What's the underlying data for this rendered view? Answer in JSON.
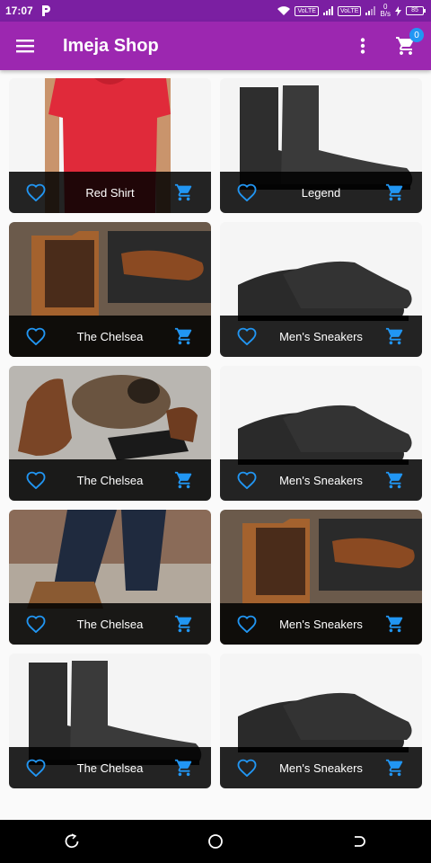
{
  "status_bar": {
    "time": "17:07",
    "volte_1": "VoLTE",
    "volte_2": "VoLTE",
    "speed_value": "0",
    "speed_unit": "B/s",
    "battery": "85"
  },
  "app_bar": {
    "title": "Imeja Shop",
    "cart_count": "0",
    "color": "#9c27b0"
  },
  "accent_color": "#2196f3",
  "products": [
    {
      "name": "Red Shirt",
      "image": "red-shirt"
    },
    {
      "name": "Legend",
      "image": "black-chelsea-boots"
    },
    {
      "name": "The Chelsea",
      "image": "brown-chelsea-boot"
    },
    {
      "name": "Men's Sneakers",
      "image": "black-sneakers"
    },
    {
      "name": "The Chelsea",
      "image": "brown-lace-boots-dog"
    },
    {
      "name": "Men's Sneakers",
      "image": "black-sneakers"
    },
    {
      "name": "The Chelsea",
      "image": "jeans-brown-boots"
    },
    {
      "name": "Men's Sneakers",
      "image": "brown-chelsea-boot"
    },
    {
      "name": "The Chelsea",
      "image": "black-chelsea-boots"
    },
    {
      "name": "Men's Sneakers",
      "image": "black-sneakers"
    }
  ],
  "icons": {
    "menu": "menu-icon",
    "more": "more-vert-icon",
    "cart": "shopping-cart-icon",
    "favorite": "heart-outline-icon",
    "back": "back-icon",
    "home": "home-icon",
    "recents": "recents-icon"
  }
}
